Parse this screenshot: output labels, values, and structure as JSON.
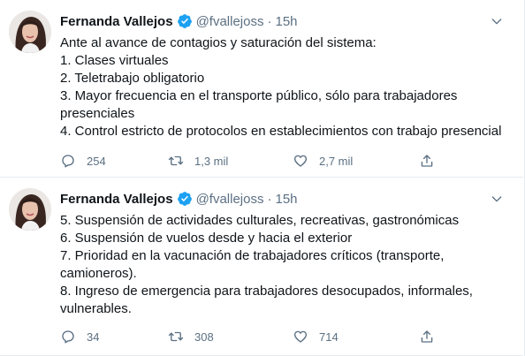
{
  "tweets": [
    {
      "author": {
        "name": "Fernanda Vallejos",
        "handle": "@fvallejoss",
        "time": "15h"
      },
      "lines": [
        "Ante al avance de contagios y saturación del sistema:",
        "1. Clases virtuales",
        "2. Teletrabajo obligatorio",
        "3. Mayor frecuencia en el transporte público, sólo para trabajadores",
        "presenciales",
        "4. Control estricto de protocolos en establecimientos con trabajo presencial"
      ],
      "stats": {
        "replies": "254",
        "retweets": "1,3 mil",
        "likes": "2,7 mil"
      }
    },
    {
      "author": {
        "name": "Fernanda Vallejos",
        "handle": "@fvallejoss",
        "time": "15h"
      },
      "lines": [
        "5. Suspensión de actividades culturales, recreativas, gastronómicas",
        "6. Suspensión de vuelos desde y hacia el exterior",
        "7. Prioridad en la vacunación de trabajadores críticos (transporte,",
        "camioneros).",
        "8. Ingreso de emergencia para trabajadores desocupados, informales,",
        "vulnerables."
      ],
      "stats": {
        "replies": "34",
        "retweets": "308",
        "likes": "714"
      }
    }
  ],
  "separator": "·",
  "icons": {
    "verified": "verified-badge-icon",
    "more": "chevron-down-icon",
    "reply": "reply-icon",
    "retweet": "retweet-icon",
    "like": "heart-icon",
    "share": "share-icon"
  },
  "colors": {
    "accent": "#1da1f2",
    "muted": "#5b7083",
    "text": "#0f1419",
    "border": "#e6ecf0"
  }
}
